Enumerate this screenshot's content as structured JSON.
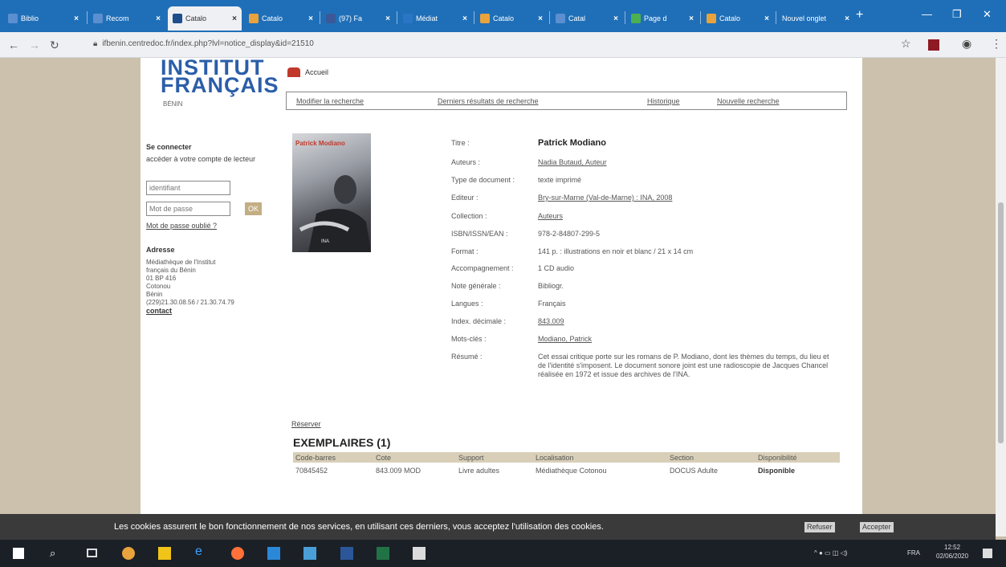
{
  "browser": {
    "tabs": [
      {
        "label": "Biblio"
      },
      {
        "label": "Recom"
      },
      {
        "label": "Catalo"
      },
      {
        "label": "Catalo"
      },
      {
        "label": "(97) Fa"
      },
      {
        "label": "Médiat"
      },
      {
        "label": "Catalo"
      },
      {
        "label": "Catal"
      },
      {
        "label": "Page d"
      },
      {
        "label": "Catalo"
      },
      {
        "label": "Nouvel onglet"
      }
    ],
    "url": "ifbenin.centredoc.fr/index.php?lvl=notice_display&id=21510"
  },
  "logo": {
    "line1": "INSTITUT",
    "line2": "FRANÇAIS",
    "sub": "BÉNIN"
  },
  "nav": {
    "home": "Accueil",
    "links": [
      "Modifier la recherche",
      "Derniers résultats de recherche",
      "Historique",
      "Nouvelle recherche"
    ]
  },
  "login": {
    "title": "Se connecter",
    "subtitle": "accéder à votre compte de lecteur",
    "id_placeholder": "identifiant",
    "pw_placeholder": "Mot de passe",
    "ok": "OK",
    "forgot": "Mot de passe oublié ?"
  },
  "address": {
    "title": "Adresse",
    "lines": [
      "Médiathèque de l'Institut",
      "français du Bénin",
      "01 BP 416",
      "Cotonou",
      "Bénin",
      "(229)21.30.08.56 / 21.30.74.79"
    ],
    "contact": "contact"
  },
  "cover": {
    "title": "Patrick Modiano",
    "foot": "INA"
  },
  "notice": {
    "fields": [
      {
        "label": "Titre :",
        "value": "Patrick Modiano"
      },
      {
        "label": "Auteurs :",
        "value": "Nadia Butaud, Auteur"
      },
      {
        "label": "Type de document :",
        "value": "texte imprimé"
      },
      {
        "label": "Editeur :",
        "value": "Bry-sur-Marne (Val-de-Marne) : INA, 2008"
      },
      {
        "label": "Collection :",
        "value": "Auteurs"
      },
      {
        "label": "ISBN/ISSN/EAN :",
        "value": "978-2-84807-299-5"
      },
      {
        "label": "Format :",
        "value": "141 p. : illustrations en noir et blanc / 21 x 14 cm"
      },
      {
        "label": "Accompagnement :",
        "value": "1 CD audio"
      },
      {
        "label": "Note générale :",
        "value": "Bibliogr."
      },
      {
        "label": "Langues :",
        "value": "Français"
      },
      {
        "label": "Index. décimale :",
        "value": "843.009"
      },
      {
        "label": "Mots-clés :",
        "value": "Modiano, Patrick"
      },
      {
        "label": "Résumé :",
        "value": ""
      }
    ],
    "resume": "Cet essai critique porte sur les romans de P. Modiano, dont les thèmes du temps, du lieu et de l'identité s'imposent. Le document sonore joint est une radioscopie de Jacques Chancel réalisée en 1972 et issue des archives de l'INA."
  },
  "holdings": {
    "reserve": "Réserver",
    "title": "EXEMPLAIRES (1)",
    "headers": [
      "Code-barres",
      "Cote",
      "Support",
      "Localisation",
      "Section",
      "Disponibilité"
    ],
    "row": [
      "70845452",
      "843.009 MOD",
      "Livre adultes",
      "Médiathèque Cotonou",
      "DOCUS Adulte",
      "Disponible"
    ]
  },
  "cookie": {
    "text": "Les cookies assurent le bon fonctionnement de nos services, en utilisant ces derniers, vous acceptez l'utilisation des cookies.",
    "refuse": "Refuser",
    "accept": "Accepter"
  },
  "taskbar": {
    "lang": "FRA",
    "time": "12:52",
    "date": "02/06/2020"
  },
  "colors": {
    "tabbar": "#1f6fb8",
    "brand": "#2b5ea9",
    "table_header": "#d9cfb8",
    "side": "#cbc1ad"
  }
}
